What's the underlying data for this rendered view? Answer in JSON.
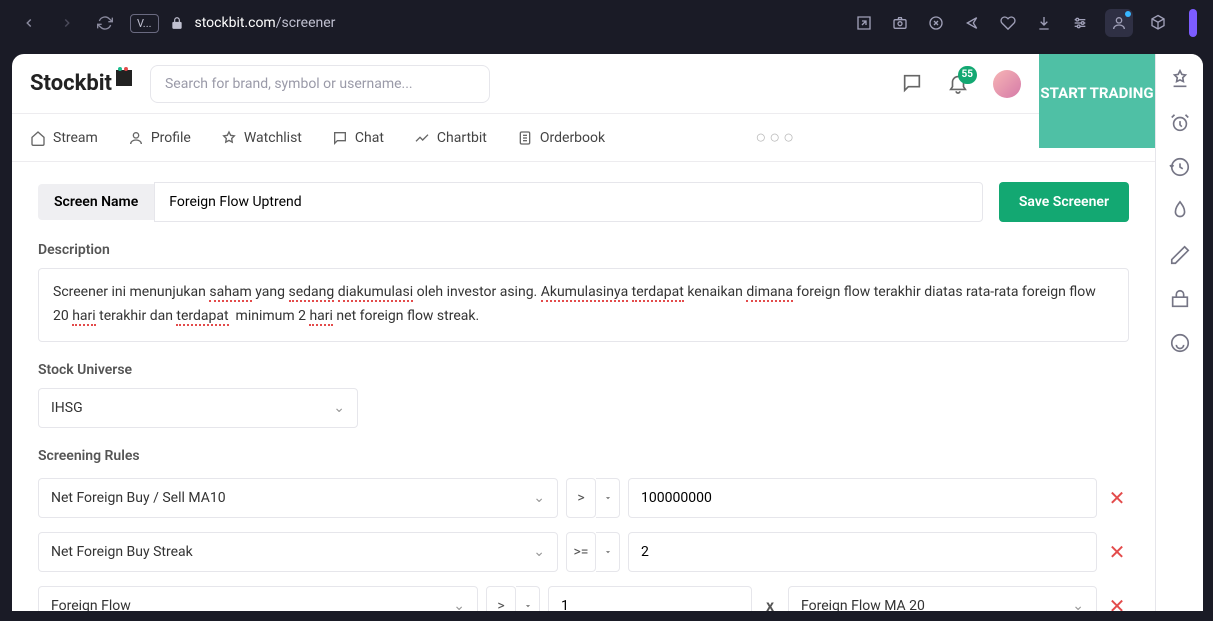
{
  "browser": {
    "url_domain": "stockbit.com",
    "url_path": "/screener",
    "tab_badge": "V..."
  },
  "header": {
    "logo_text": "Stockbit",
    "search_placeholder": "Search for brand, symbol or username...",
    "notification_count": "55",
    "start_trading": "START TRADING"
  },
  "tabs": {
    "stream": "Stream",
    "profile": "Profile",
    "watchlist": "Watchlist",
    "chat": "Chat",
    "chartbit": "Chartbit",
    "orderbook": "Orderbook"
  },
  "form": {
    "screen_name_label": "Screen Name",
    "screen_name_value": "Foreign Flow Uptrend",
    "save_button": "Save Screener",
    "description_label": "Description",
    "description_value": "Screener ini menunjukan saham yang sedang diakumulasi oleh investor asing. Akumulasinya terdapat kenaikan dimana foreign flow terakhir diatas rata-rata foreign flow 20 hari terakhir dan terdapat  minimum 2 hari net foreign flow streak.",
    "stock_universe_label": "Stock Universe",
    "stock_universe_value": "IHSG",
    "screening_rules_label": "Screening Rules",
    "rules": [
      {
        "metric": "Net Foreign Buy / Sell MA10",
        "operator": ">",
        "value": "100000000"
      },
      {
        "metric": "Net Foreign Buy Streak",
        "operator": ">=",
        "value": "2"
      },
      {
        "metric": "Foreign Flow",
        "operator": ">",
        "value": "1",
        "mult": "x",
        "metric2": "Foreign Flow MA 20"
      }
    ]
  }
}
